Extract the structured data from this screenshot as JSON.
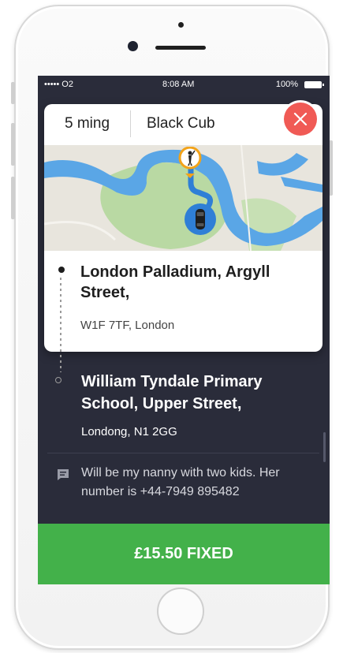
{
  "status_bar": {
    "carrier": "••••• O2",
    "time": "8:08 AM",
    "battery": "100%"
  },
  "card": {
    "eta": "5 ming",
    "car_type": "Black Cub",
    "pickup": {
      "title": "London Palladium, Argyll Street,",
      "subtitle": "W1F 7TF, London"
    }
  },
  "destination": {
    "title": "William Tyndale Primary School, Upper Street,",
    "subtitle": "Londong, N1 2GG"
  },
  "note": {
    "text": "Will be my nanny with two kids. Her number is +44-7949 895482"
  },
  "price": {
    "label": "£15.50 FIXED"
  },
  "colors": {
    "screen_bg": "#2a2c3a",
    "accent_green": "#43b14a",
    "close_red": "#f05a55",
    "map_water": "#5aa6e6"
  },
  "icons": [
    "close-icon",
    "car-icon",
    "passenger-pin-icon",
    "message-icon",
    "battery-icon"
  ]
}
